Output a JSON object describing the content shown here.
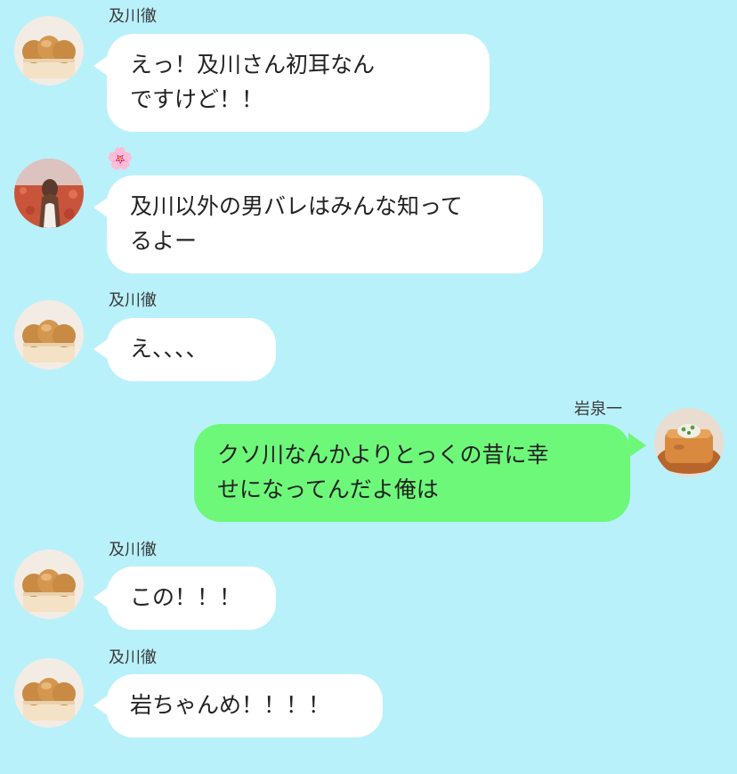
{
  "colors": {
    "background": "#b9f1fb",
    "incoming_bubble": "#ffffff",
    "outgoing_bubble": "#6df87a"
  },
  "messages": [
    {
      "sender": "及川徹",
      "avatar": "bread-avatar-icon",
      "side": "left",
      "lines": [
        "えっ！及川さん初耳なん",
        "ですけど！！"
      ]
    },
    {
      "sender": "",
      "sender_icon": "🌸",
      "avatar": "flower-field-avatar-icon",
      "side": "left",
      "lines": [
        "及川以外の男バレはみんな知って",
        "るよー"
      ]
    },
    {
      "sender": "及川徹",
      "avatar": "bread-avatar-icon",
      "side": "left",
      "lines": [
        "え、、、、"
      ]
    },
    {
      "sender": "岩泉一",
      "avatar": "agedashi-tofu-avatar-icon",
      "side": "right",
      "lines": [
        "クソ川なんかよりとっくの昔に幸",
        "せになってんだよ俺は"
      ]
    },
    {
      "sender": "及川徹",
      "avatar": "bread-avatar-icon",
      "side": "left",
      "lines": [
        "この！！！"
      ]
    },
    {
      "sender": "及川徹",
      "avatar": "bread-avatar-icon",
      "side": "left",
      "lines": [
        "岩ちゃんめ！！！！"
      ]
    }
  ]
}
